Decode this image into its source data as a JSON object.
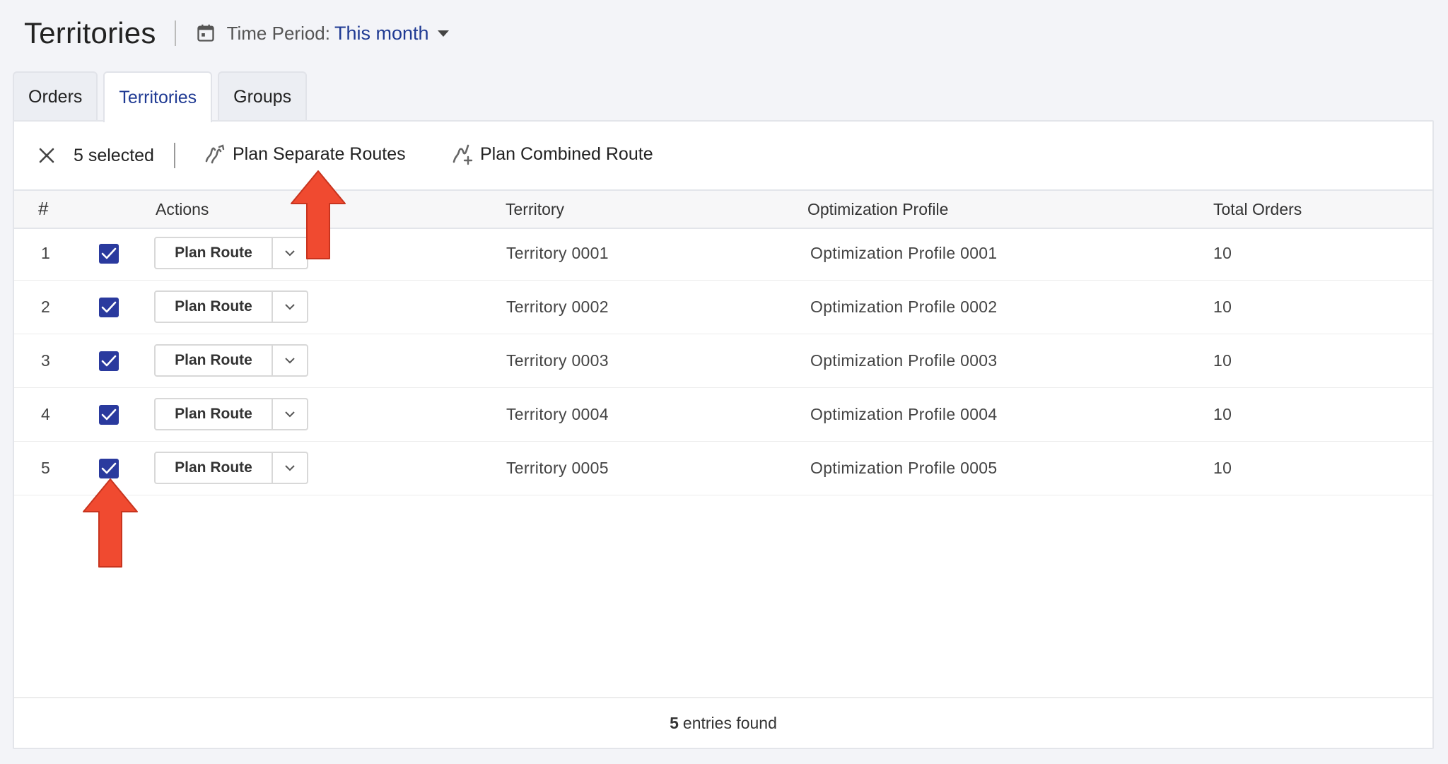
{
  "header": {
    "title": "Territories",
    "time_period_label": "Time Period:",
    "time_period_value": "This month"
  },
  "tabs": [
    {
      "label": "Orders",
      "active": false
    },
    {
      "label": "Territories",
      "active": true
    },
    {
      "label": "Groups",
      "active": false
    }
  ],
  "toolbar": {
    "selected_text": "5 selected",
    "plan_separate": "Plan Separate Routes",
    "plan_combined": "Plan Combined Route"
  },
  "table": {
    "columns": [
      "#",
      "Actions",
      "Territory",
      "Optimization Profile",
      "Total Orders"
    ],
    "rows": [
      {
        "num": "1",
        "checked": true,
        "action": "Plan Route",
        "territory": "Territory 0001",
        "profile": "Optimization Profile 0001",
        "orders": "10"
      },
      {
        "num": "2",
        "checked": true,
        "action": "Plan Route",
        "territory": "Territory 0002",
        "profile": "Optimization Profile 0002",
        "orders": "10"
      },
      {
        "num": "3",
        "checked": true,
        "action": "Plan Route",
        "territory": "Territory 0003",
        "profile": "Optimization Profile 0003",
        "orders": "10"
      },
      {
        "num": "4",
        "checked": true,
        "action": "Plan Route",
        "territory": "Territory 0004",
        "profile": "Optimization Profile 0004",
        "orders": "10"
      },
      {
        "num": "5",
        "checked": true,
        "action": "Plan Route",
        "territory": "Territory 0005",
        "profile": "Optimization Profile 0005",
        "orders": "10"
      }
    ]
  },
  "footer": {
    "count": "5",
    "suffix": "entries found"
  },
  "colors": {
    "accent": "#1f3a93",
    "checkbox": "#2a3a9e",
    "annotation_arrow": "#f04a30"
  },
  "icons": [
    "calendar-icon",
    "caret-down-icon",
    "close-icon",
    "plan-separate-routes-icon",
    "plan-combined-route-icon",
    "checkmark-icon",
    "chevron-down-icon",
    "annotation-arrow-up"
  ]
}
